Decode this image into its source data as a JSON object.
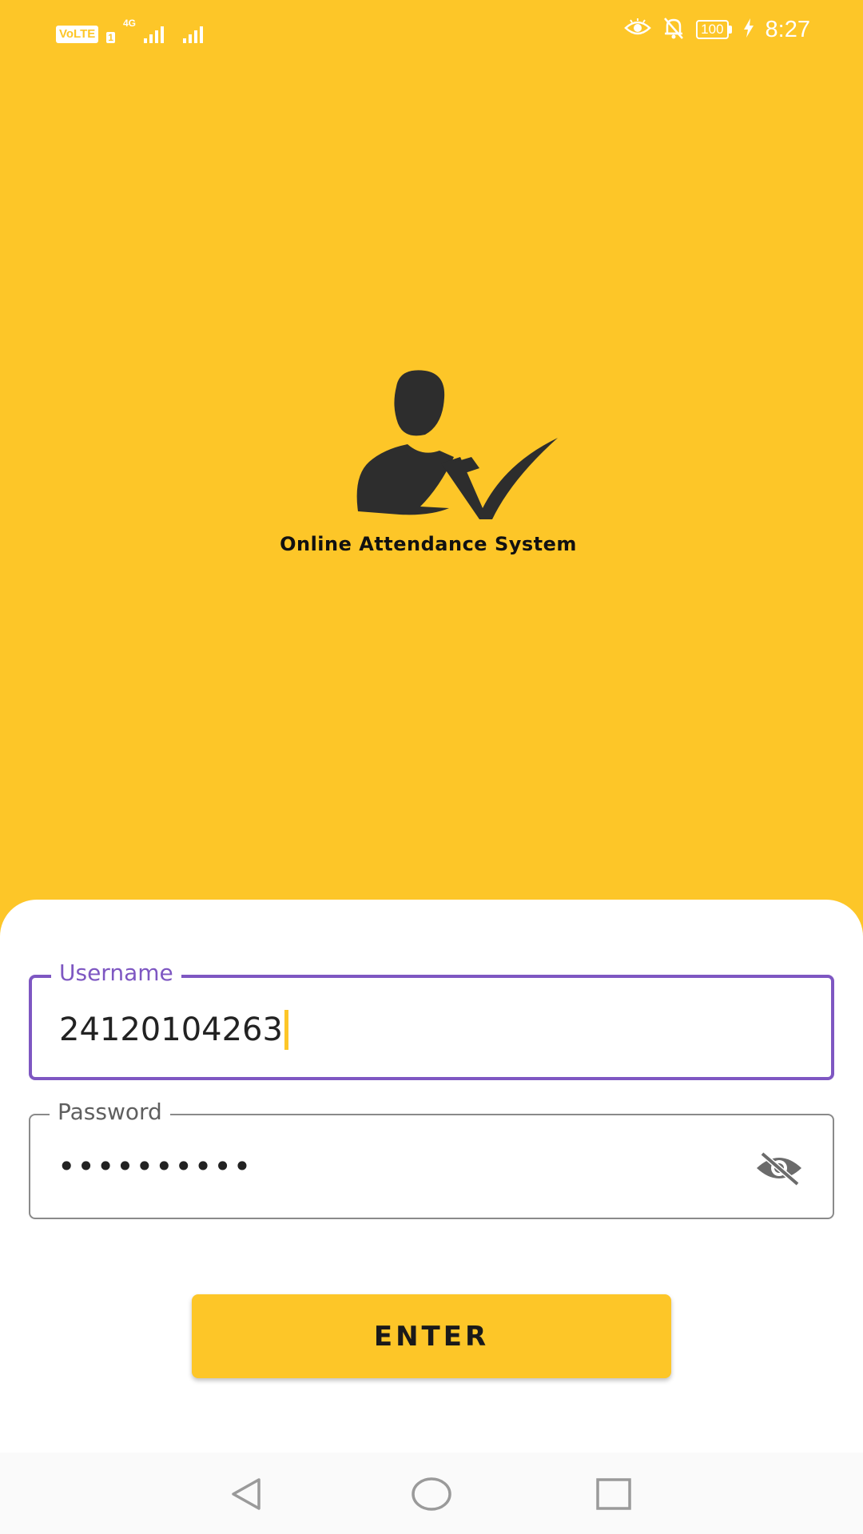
{
  "status_bar": {
    "volte_label": "VoLTE",
    "sim_number": "1",
    "network_type": "4G",
    "battery_level": "100",
    "time": "8:27",
    "icons": [
      "eye-comfort-icon",
      "notifications-off-icon",
      "charging-icon"
    ]
  },
  "app": {
    "title": "Online Attendance System",
    "background_color": "#FDC628",
    "logo_icon": "user-checkmark-icon"
  },
  "login": {
    "username_label": "Username",
    "username_value": "24120104263",
    "password_label": "Password",
    "password_value": "••••••••••",
    "password_toggle_icon": "visibility-off-icon",
    "enter_label": "ENTER",
    "focused_field_color": "#7E57C2"
  },
  "navigation": {
    "buttons": [
      "back-icon",
      "home-icon",
      "recents-icon"
    ]
  }
}
